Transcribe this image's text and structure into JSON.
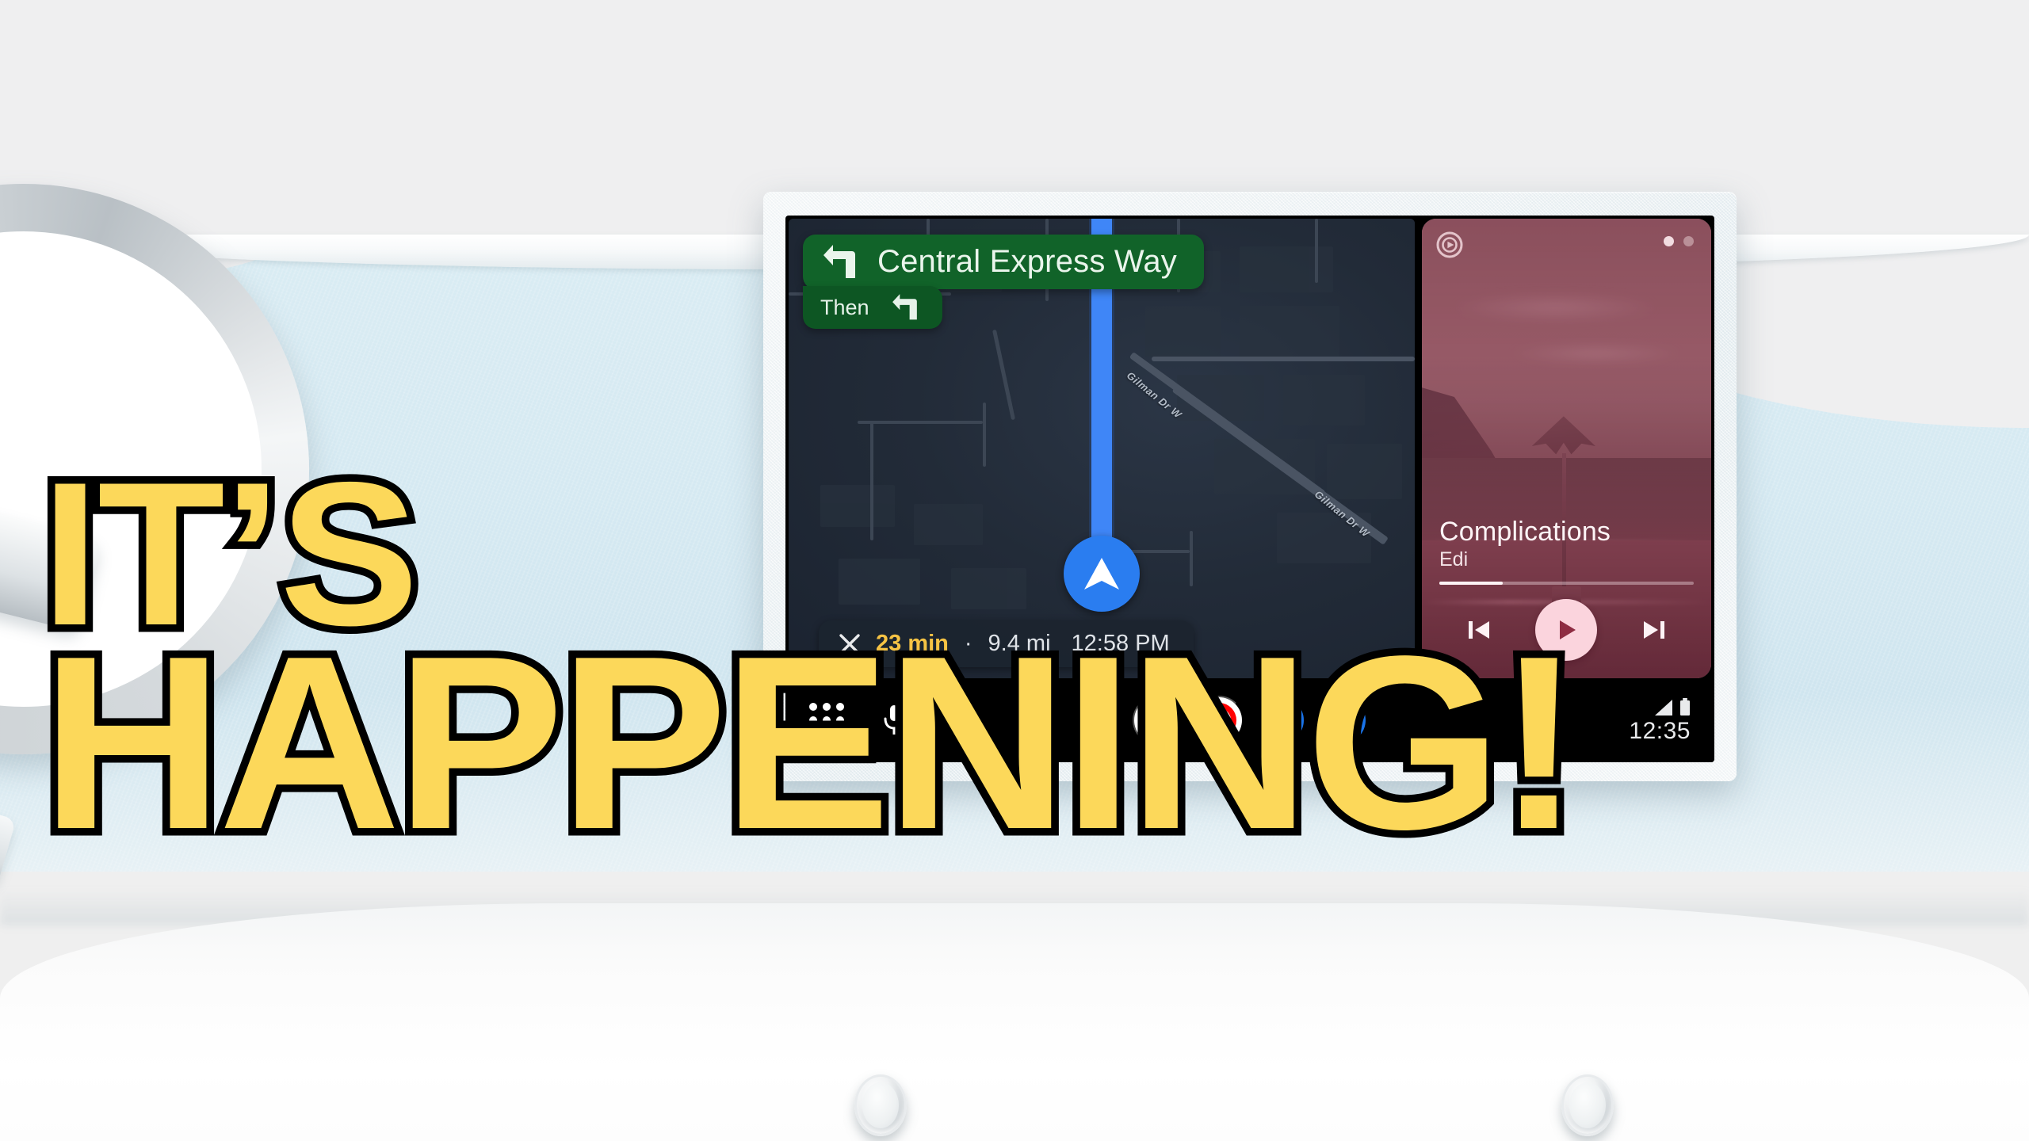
{
  "headline": {
    "line1": "IT’S",
    "line2": "HAPPENING!",
    "fill_color": "#fcd85a",
    "stroke_color": "#000000"
  },
  "navigation": {
    "maneuver_icon": "turn-left-arrow-icon",
    "street": "Central Express Way",
    "then_label": "Then",
    "then_icon": "turn-left-arrow-icon",
    "banner_color": "#116329",
    "road_labels": [
      "Gilman Dr W",
      "Gilman Dr W"
    ],
    "route_color": "#3f86f7",
    "position_marker": "navigation-arrow-icon"
  },
  "trip": {
    "close_icon": "close-x-icon",
    "duration": "23 min",
    "separator": "·",
    "distance": "9.4 mi",
    "arrival_time": "12:58 PM",
    "duration_color": "#f6c344"
  },
  "media": {
    "app_icon": "youtube-music-icon",
    "title": "Complications",
    "artist": "Edi",
    "progress_percent": 25,
    "previous_icon": "skip-previous-icon",
    "play_icon": "play-icon",
    "next_icon": "skip-next-icon",
    "accent_color": "#fbd4dd",
    "card_color": "#7d3a4b",
    "page_dots": 2,
    "active_dot_index": 0
  },
  "taskbar": {
    "launcher_icon": "app-grid-icon",
    "mic_icon": "microphone-icon",
    "apps": [
      {
        "name": "Google Maps",
        "icon": "google-maps-icon"
      },
      {
        "name": "YouTube Music",
        "icon": "youtube-music-icon"
      },
      {
        "name": "Messages",
        "icon": "messages-icon"
      },
      {
        "name": "Phone",
        "icon": "phone-icon"
      }
    ],
    "signal_icon": "signal-bars-icon",
    "battery_icon": "battery-icon",
    "clock": "12:35"
  },
  "interior": {
    "dashboard_color": "#d5e9f2",
    "upper_color": "#efeff0",
    "console_color": "#ffffff",
    "knob_count": 2,
    "steering_wheel": "steering-wheel"
  }
}
